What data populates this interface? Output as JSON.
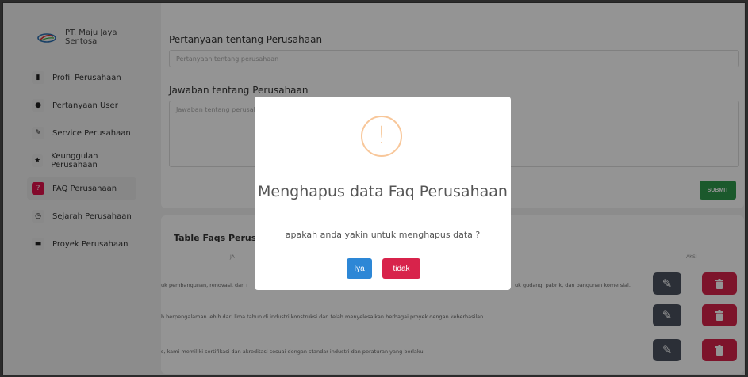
{
  "brand": {
    "name": "PT. Maju Jaya Sentosa"
  },
  "sidebar": {
    "items": [
      {
        "label": "Profil Perusahaan",
        "icon": "building-icon"
      },
      {
        "label": "Pertanyaan User",
        "icon": "user-circle-icon"
      },
      {
        "label": "Service Perusahaan",
        "icon": "wrench-icon"
      },
      {
        "label": "Keunggulan Perusahaan",
        "icon": "star-icon"
      },
      {
        "label": "FAQ Perusahaan",
        "icon": "question-icon",
        "active": true
      },
      {
        "label": "Sejarah Perusahaan",
        "icon": "history-icon"
      },
      {
        "label": "Proyek Perusahaan",
        "icon": "briefcase-icon"
      }
    ]
  },
  "form": {
    "question_label": "Pertanyaan tentang Perusahaan",
    "question_placeholder": "Pertanyaan tentang perusahaan",
    "answer_label": "Jawaban tentang Perusahaan",
    "answer_placeholder": "Jawaban tentang perusahaan",
    "submit_label": "SUBMIT"
  },
  "table": {
    "title": "Table Faqs Perusahaan",
    "columns": [
      "JA",
      "AKSI"
    ],
    "rows": [
      {
        "text_left": "uk pembangunan, renovasi, dan r",
        "text_right": "uk gudang, pabrik, dan bangunan komersial."
      },
      {
        "text_left": "h berpengalaman lebih dari lima tahun di industri konstruksi dan telah menyelesaikan berbagai proyek dengan keberhasilan.",
        "text_right": ""
      },
      {
        "text_left": "s, kami memiliki sertifikasi dan akreditasi sesuai dengan standar industri dan peraturan yang berlaku.",
        "text_right": ""
      }
    ]
  },
  "modal": {
    "title": "Menghapus data Faq Perusahaan",
    "text": "apakah anda yakin untuk menghapus data ?",
    "confirm_label": "Iya",
    "cancel_label": "tidak",
    "icon": "warning-exclamation-icon"
  },
  "colors": {
    "accent_danger": "#d8234b",
    "accent_success": "#2f9a4d",
    "accent_primary": "#2d87d6",
    "warning": "#f5b97e"
  }
}
